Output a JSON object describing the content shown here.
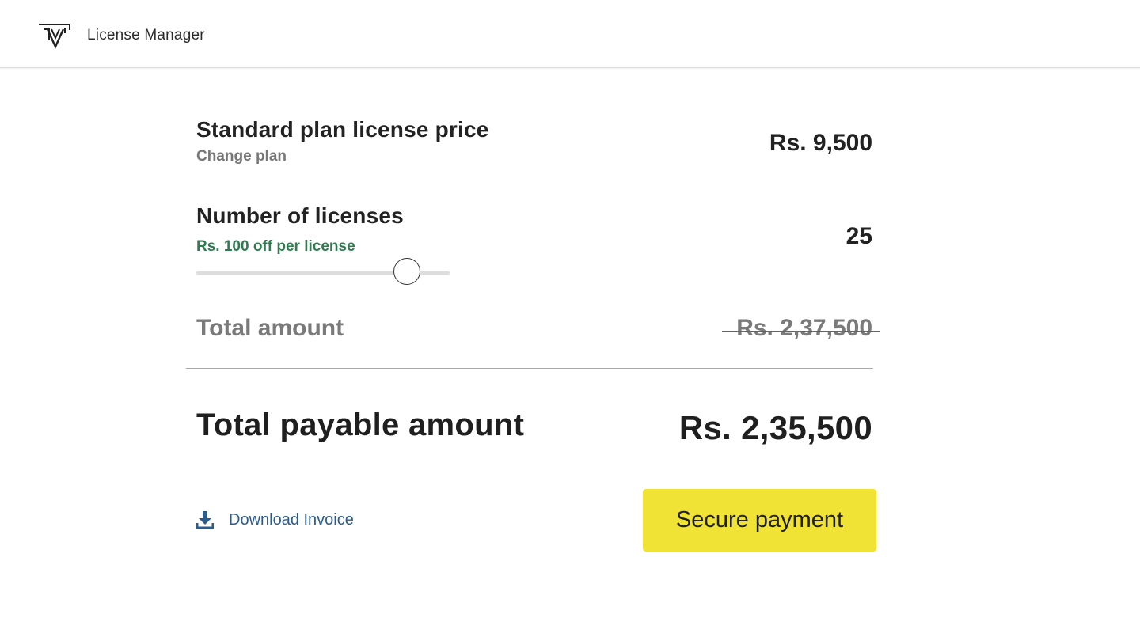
{
  "header": {
    "app_title": "License Manager",
    "logo_icon": "license-manager-logo"
  },
  "plan": {
    "label": "Standard plan license price",
    "change_link": "Change plan",
    "price": "Rs. 9,500"
  },
  "licenses": {
    "label": "Number of licenses",
    "discount_text": "Rs. 100 off per license",
    "count": "25",
    "slider_fraction": 0.83
  },
  "total": {
    "label": "Total amount",
    "original_amount": "Rs. 2,37,500"
  },
  "payable": {
    "label": "Total payable amount",
    "amount": "Rs. 2,35,500"
  },
  "actions": {
    "download_label": "Download Invoice",
    "download_icon": "download-icon",
    "pay_label": "Secure payment"
  },
  "colors": {
    "accent_button": "#f0e335",
    "discount_green": "#2e7d4f",
    "link_blue": "#2b5d8c"
  }
}
